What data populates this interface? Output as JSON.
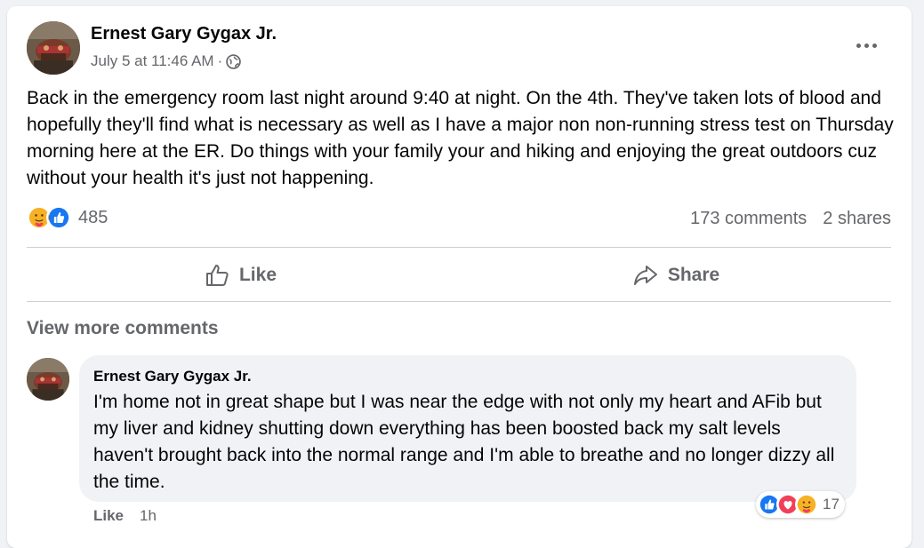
{
  "post": {
    "author": "Ernest Gary Gygax Jr.",
    "timestamp": "July 5 at 11:46 AM",
    "separator": "·",
    "privacy_icon": "globe-icon",
    "more_icon": "more-options-icon",
    "text": "Back in the emergency room last night around 9:40 at night. On the 4th. They've taken lots of blood and hopefully they'll find what is necessary as well as I have a major non non-running stress test on Thursday morning here at the ER. Do things with your family your and hiking and enjoying the great outdoors cuz without your health it's just not happening.",
    "reactions": {
      "types": [
        "care",
        "like"
      ],
      "count": "485"
    },
    "comments_count": "173 comments",
    "shares_count": "2 shares"
  },
  "actions": {
    "like_label": "Like",
    "share_label": "Share"
  },
  "comments_section": {
    "view_more_label": "View more comments",
    "comment": {
      "author": "Ernest Gary Gygax Jr.",
      "text": "I'm home not in great shape but I was near the edge with not only my heart and AFib but my liver and kidney shutting down everything has been boosted back my salt levels haven't brought back into the normal range and I'm able to breathe and no longer dizzy all the time.",
      "reactions": {
        "types": [
          "like",
          "love",
          "care"
        ],
        "count": "17"
      },
      "like_label": "Like",
      "time": "1h"
    }
  },
  "colors": {
    "background": "#f0f2f5",
    "card": "#ffffff",
    "primary_text": "#050505",
    "secondary_text": "#65676b",
    "like_blue": "#1877f2",
    "love_red": "#f33e58",
    "care_yellow": "#f7b125"
  }
}
